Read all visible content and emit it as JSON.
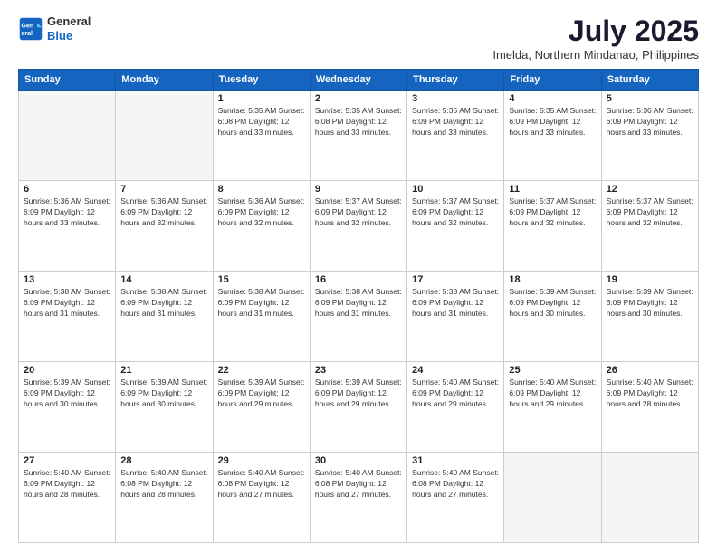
{
  "logo": {
    "line1": "General",
    "line2": "Blue"
  },
  "title": "July 2025",
  "subtitle": "Imelda, Northern Mindanao, Philippines",
  "days_header": [
    "Sunday",
    "Monday",
    "Tuesday",
    "Wednesday",
    "Thursday",
    "Friday",
    "Saturday"
  ],
  "weeks": [
    [
      {
        "day": "",
        "info": ""
      },
      {
        "day": "",
        "info": ""
      },
      {
        "day": "1",
        "info": "Sunrise: 5:35 AM\nSunset: 6:08 PM\nDaylight: 12 hours\nand 33 minutes."
      },
      {
        "day": "2",
        "info": "Sunrise: 5:35 AM\nSunset: 6:08 PM\nDaylight: 12 hours\nand 33 minutes."
      },
      {
        "day": "3",
        "info": "Sunrise: 5:35 AM\nSunset: 6:09 PM\nDaylight: 12 hours\nand 33 minutes."
      },
      {
        "day": "4",
        "info": "Sunrise: 5:35 AM\nSunset: 6:09 PM\nDaylight: 12 hours\nand 33 minutes."
      },
      {
        "day": "5",
        "info": "Sunrise: 5:36 AM\nSunset: 6:09 PM\nDaylight: 12 hours\nand 33 minutes."
      }
    ],
    [
      {
        "day": "6",
        "info": "Sunrise: 5:36 AM\nSunset: 6:09 PM\nDaylight: 12 hours\nand 33 minutes."
      },
      {
        "day": "7",
        "info": "Sunrise: 5:36 AM\nSunset: 6:09 PM\nDaylight: 12 hours\nand 32 minutes."
      },
      {
        "day": "8",
        "info": "Sunrise: 5:36 AM\nSunset: 6:09 PM\nDaylight: 12 hours\nand 32 minutes."
      },
      {
        "day": "9",
        "info": "Sunrise: 5:37 AM\nSunset: 6:09 PM\nDaylight: 12 hours\nand 32 minutes."
      },
      {
        "day": "10",
        "info": "Sunrise: 5:37 AM\nSunset: 6:09 PM\nDaylight: 12 hours\nand 32 minutes."
      },
      {
        "day": "11",
        "info": "Sunrise: 5:37 AM\nSunset: 6:09 PM\nDaylight: 12 hours\nand 32 minutes."
      },
      {
        "day": "12",
        "info": "Sunrise: 5:37 AM\nSunset: 6:09 PM\nDaylight: 12 hours\nand 32 minutes."
      }
    ],
    [
      {
        "day": "13",
        "info": "Sunrise: 5:38 AM\nSunset: 6:09 PM\nDaylight: 12 hours\nand 31 minutes."
      },
      {
        "day": "14",
        "info": "Sunrise: 5:38 AM\nSunset: 6:09 PM\nDaylight: 12 hours\nand 31 minutes."
      },
      {
        "day": "15",
        "info": "Sunrise: 5:38 AM\nSunset: 6:09 PM\nDaylight: 12 hours\nand 31 minutes."
      },
      {
        "day": "16",
        "info": "Sunrise: 5:38 AM\nSunset: 6:09 PM\nDaylight: 12 hours\nand 31 minutes."
      },
      {
        "day": "17",
        "info": "Sunrise: 5:38 AM\nSunset: 6:09 PM\nDaylight: 12 hours\nand 31 minutes."
      },
      {
        "day": "18",
        "info": "Sunrise: 5:39 AM\nSunset: 6:09 PM\nDaylight: 12 hours\nand 30 minutes."
      },
      {
        "day": "19",
        "info": "Sunrise: 5:39 AM\nSunset: 6:09 PM\nDaylight: 12 hours\nand 30 minutes."
      }
    ],
    [
      {
        "day": "20",
        "info": "Sunrise: 5:39 AM\nSunset: 6:09 PM\nDaylight: 12 hours\nand 30 minutes."
      },
      {
        "day": "21",
        "info": "Sunrise: 5:39 AM\nSunset: 6:09 PM\nDaylight: 12 hours\nand 30 minutes."
      },
      {
        "day": "22",
        "info": "Sunrise: 5:39 AM\nSunset: 6:09 PM\nDaylight: 12 hours\nand 29 minutes."
      },
      {
        "day": "23",
        "info": "Sunrise: 5:39 AM\nSunset: 6:09 PM\nDaylight: 12 hours\nand 29 minutes."
      },
      {
        "day": "24",
        "info": "Sunrise: 5:40 AM\nSunset: 6:09 PM\nDaylight: 12 hours\nand 29 minutes."
      },
      {
        "day": "25",
        "info": "Sunrise: 5:40 AM\nSunset: 6:09 PM\nDaylight: 12 hours\nand 29 minutes."
      },
      {
        "day": "26",
        "info": "Sunrise: 5:40 AM\nSunset: 6:09 PM\nDaylight: 12 hours\nand 28 minutes."
      }
    ],
    [
      {
        "day": "27",
        "info": "Sunrise: 5:40 AM\nSunset: 6:09 PM\nDaylight: 12 hours\nand 28 minutes."
      },
      {
        "day": "28",
        "info": "Sunrise: 5:40 AM\nSunset: 6:08 PM\nDaylight: 12 hours\nand 28 minutes."
      },
      {
        "day": "29",
        "info": "Sunrise: 5:40 AM\nSunset: 6:08 PM\nDaylight: 12 hours\nand 27 minutes."
      },
      {
        "day": "30",
        "info": "Sunrise: 5:40 AM\nSunset: 6:08 PM\nDaylight: 12 hours\nand 27 minutes."
      },
      {
        "day": "31",
        "info": "Sunrise: 5:40 AM\nSunset: 6:08 PM\nDaylight: 12 hours\nand 27 minutes."
      },
      {
        "day": "",
        "info": ""
      },
      {
        "day": "",
        "info": ""
      }
    ]
  ]
}
